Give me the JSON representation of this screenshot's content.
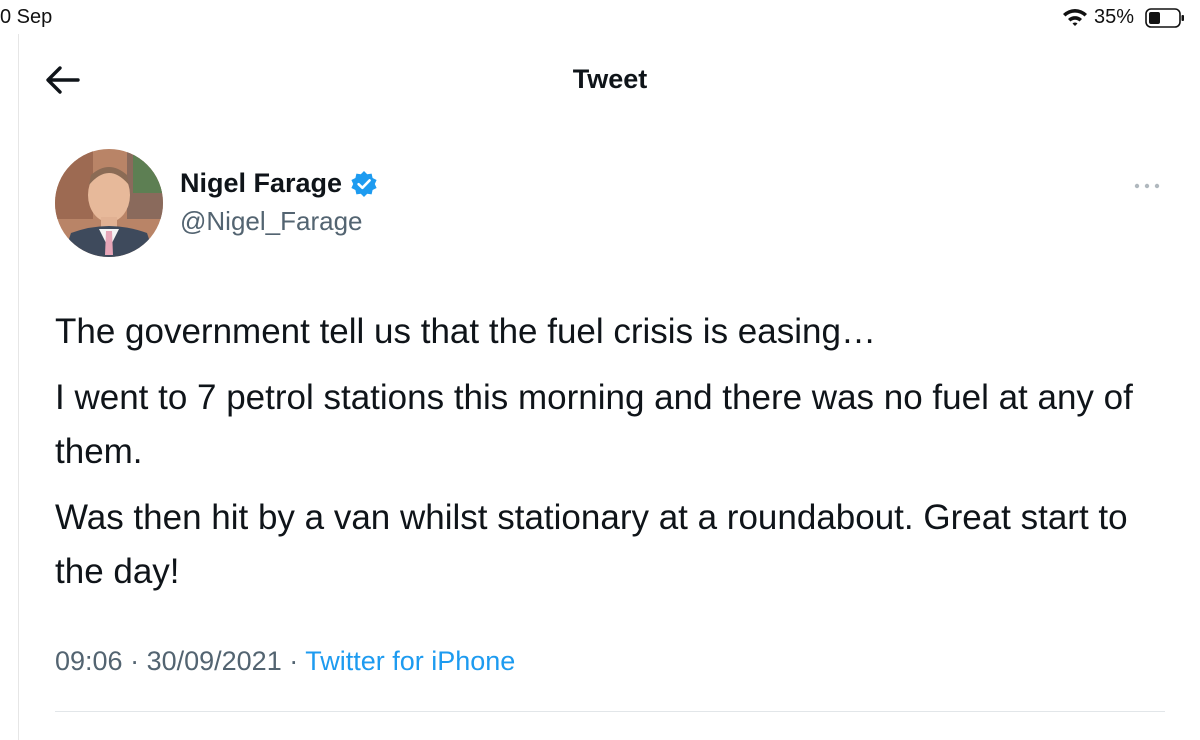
{
  "status_bar": {
    "date": "0 Sep",
    "battery_percent": "35%",
    "icons": [
      "wifi-icon",
      "battery-icon"
    ]
  },
  "header": {
    "title": "Tweet",
    "back_icon": "arrow-left-icon"
  },
  "author": {
    "name": "Nigel Farage",
    "handle": "@Nigel_Farage",
    "verified": true,
    "verified_color": "#1d9bf0"
  },
  "tweet": {
    "paragraphs": [
      "The government tell us that the fuel crisis is easing…",
      "I went to 7 petrol stations this morning and there was no fuel at any of them.",
      "Was then hit by a van whilst stationary at a roundabout. Great start to the day!"
    ],
    "time": "09:06",
    "separator": " · ",
    "date": "30/09/2021",
    "source": "Twitter for iPhone"
  },
  "colors": {
    "text": "#0f1419",
    "secondary": "#536471",
    "accent": "#1d9bf0"
  }
}
